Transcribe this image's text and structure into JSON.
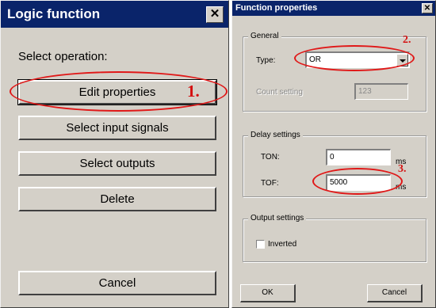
{
  "logic_dialog": {
    "title": "Logic function",
    "close_glyph": "✕",
    "prompt": "Select operation:",
    "buttons": {
      "edit": "Edit properties",
      "inputs": "Select input signals",
      "outputs": "Select outputs",
      "delete": "Delete",
      "cancel": "Cancel"
    }
  },
  "props_dialog": {
    "title": "Function properties",
    "close_glyph": "✕",
    "general": {
      "group_label": "General",
      "type_label": "Type:",
      "type_value": "OR",
      "count_label": "Count setting",
      "count_value": "123"
    },
    "delay": {
      "group_label": "Delay settings",
      "ton_label": "TON:",
      "ton_value": "0",
      "ton_unit": "ms",
      "tof_label": "TOF:",
      "tof_value": "5000",
      "tof_unit": "ms"
    },
    "output": {
      "group_label": "Output settings",
      "inverted_label": "Inverted",
      "inverted_checked": false
    },
    "ok_label": "OK",
    "cancel_label": "Cancel"
  },
  "annotations": {
    "step1": "1.",
    "step2": "2.",
    "step3": "3.",
    "color": "#e01818"
  }
}
